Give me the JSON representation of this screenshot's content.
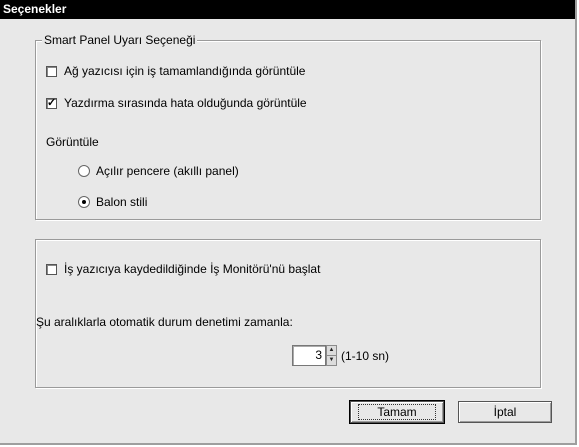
{
  "window": {
    "title": "Seçenekler"
  },
  "smart_panel": {
    "legend": "Smart Panel Uyarı Seçeneği",
    "network_option": {
      "label": "Ağ yazıcısı için iş tamamlandığında görüntüle",
      "checked": false
    },
    "error_option": {
      "label": "Yazdırma sırasında hata olduğunda görüntüle",
      "checked": true
    },
    "display_heading": "Görüntüle",
    "display_options": [
      {
        "label": "Açılır pencere (akıllı panel)",
        "selected": false
      },
      {
        "label": "Balon stili",
        "selected": true
      }
    ]
  },
  "monitor": {
    "start_option": {
      "label": "İş yazıcıya kaydedildiğinde İş Monitörü'nü başlat",
      "checked": false
    },
    "schedule_label": "Şu aralıklarla otomatik durum denetimi zamanla:",
    "interval_value": "3",
    "interval_range": "(1-10 sn)"
  },
  "buttons": {
    "ok": "Tamam",
    "cancel": "İptal"
  }
}
